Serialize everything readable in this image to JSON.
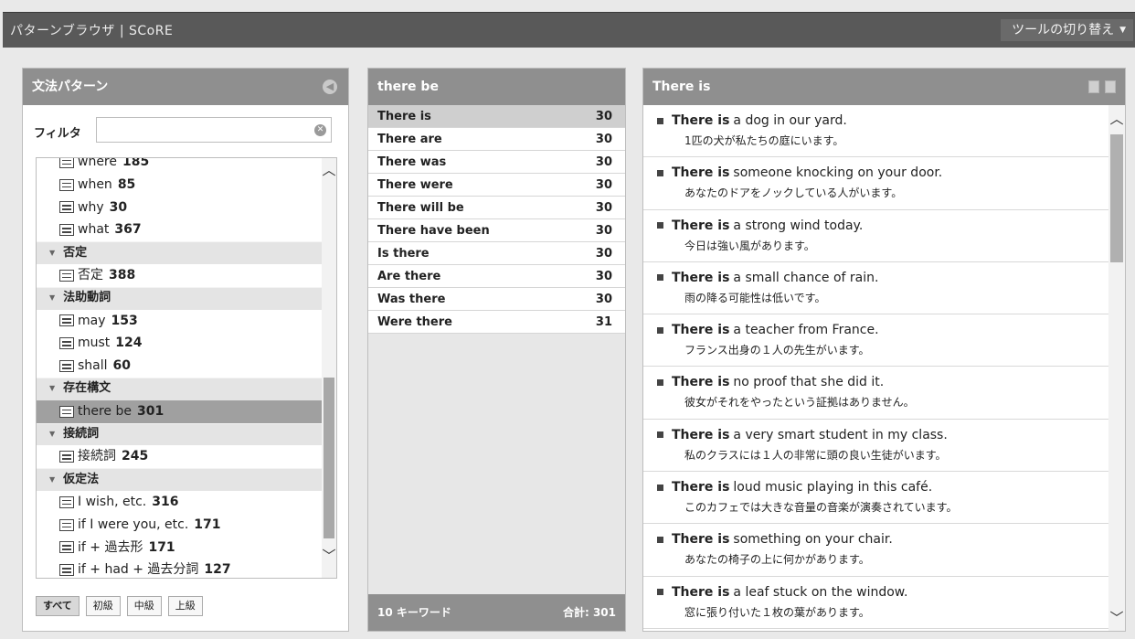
{
  "app": {
    "title": "パターンブラウザ | SCoRE",
    "tool_switch": "ツールの切り替え"
  },
  "left": {
    "title": "文法パターン",
    "filter_label": "フィルタ",
    "filter_value": "",
    "tree": [
      {
        "type": "leaf",
        "label": "where",
        "count": "185"
      },
      {
        "type": "leaf",
        "label": "when",
        "count": "85"
      },
      {
        "type": "leaf",
        "label": "why",
        "count": "30"
      },
      {
        "type": "leaf",
        "label": "what",
        "count": "367"
      },
      {
        "type": "cat",
        "label": "否定"
      },
      {
        "type": "leaf",
        "label": "否定",
        "count": "388"
      },
      {
        "type": "cat",
        "label": "法助動詞"
      },
      {
        "type": "leaf",
        "label": "may",
        "count": "153"
      },
      {
        "type": "leaf",
        "label": "must",
        "count": "124"
      },
      {
        "type": "leaf",
        "label": "shall",
        "count": "60"
      },
      {
        "type": "cat",
        "label": "存在構文"
      },
      {
        "type": "leaf",
        "label": "there be",
        "count": "301",
        "selected": true
      },
      {
        "type": "cat",
        "label": "接続詞"
      },
      {
        "type": "leaf",
        "label": "接続詞",
        "count": "245"
      },
      {
        "type": "cat",
        "label": "仮定法"
      },
      {
        "type": "leaf",
        "label": "I wish, etc.",
        "count": "316"
      },
      {
        "type": "leaf",
        "label": "if I were you, etc.",
        "count": "171"
      },
      {
        "type": "leaf",
        "label": "if + 過去形",
        "count": "171"
      },
      {
        "type": "leaf",
        "label": "if + had + 過去分詞",
        "count": "127"
      }
    ],
    "levels": [
      {
        "label": "すべて",
        "active": true
      },
      {
        "label": "初級"
      },
      {
        "label": "中級"
      },
      {
        "label": "上級"
      }
    ]
  },
  "middle": {
    "title": "there be",
    "keywords": [
      {
        "label": "There is",
        "count": "30",
        "selected": true
      },
      {
        "label": "There are",
        "count": "30"
      },
      {
        "label": "There was",
        "count": "30"
      },
      {
        "label": "There were",
        "count": "30"
      },
      {
        "label": "There will be",
        "count": "30"
      },
      {
        "label": "There have been",
        "count": "30"
      },
      {
        "label": "Is there",
        "count": "30"
      },
      {
        "label": "Are there",
        "count": "30"
      },
      {
        "label": "Was there",
        "count": "30"
      },
      {
        "label": "Were there",
        "count": "31"
      }
    ],
    "footer_left": "10 キーワード",
    "footer_right": "合計: 301"
  },
  "right": {
    "title": "There is",
    "examples": [
      {
        "kw": "There is",
        "rest": "a dog in our yard.",
        "ja": "1匹の犬が私たちの庭にいます。"
      },
      {
        "kw": "There is",
        "rest": "someone knocking on your door.",
        "ja": "あなたのドアをノックしている人がいます。"
      },
      {
        "kw": "There is",
        "rest": "a strong wind today.",
        "ja": "今日は強い風があります。"
      },
      {
        "kw": "There is",
        "rest": "a small chance of rain.",
        "ja": "雨の降る可能性は低いです。"
      },
      {
        "kw": "There is",
        "rest": "a teacher from France.",
        "ja": "フランス出身の１人の先生がいます。"
      },
      {
        "kw": "There is",
        "rest": "no proof that she did it.",
        "ja": "彼女がそれをやったという証拠はありません。"
      },
      {
        "kw": "There is",
        "rest": "a very smart student in my class.",
        "ja": "私のクラスには１人の非常に頭の良い生徒がいます。"
      },
      {
        "kw": "There is",
        "rest": "loud music playing in this café.",
        "ja": "このカフェでは大きな音量の音楽が演奏されています。"
      },
      {
        "kw": "There is",
        "rest": "something on your chair.",
        "ja": "あなたの椅子の上に何かがあります。"
      },
      {
        "kw": "There is",
        "rest": "a leaf stuck on the window.",
        "ja": "窓に張り付いた１枚の葉があります。"
      }
    ]
  }
}
